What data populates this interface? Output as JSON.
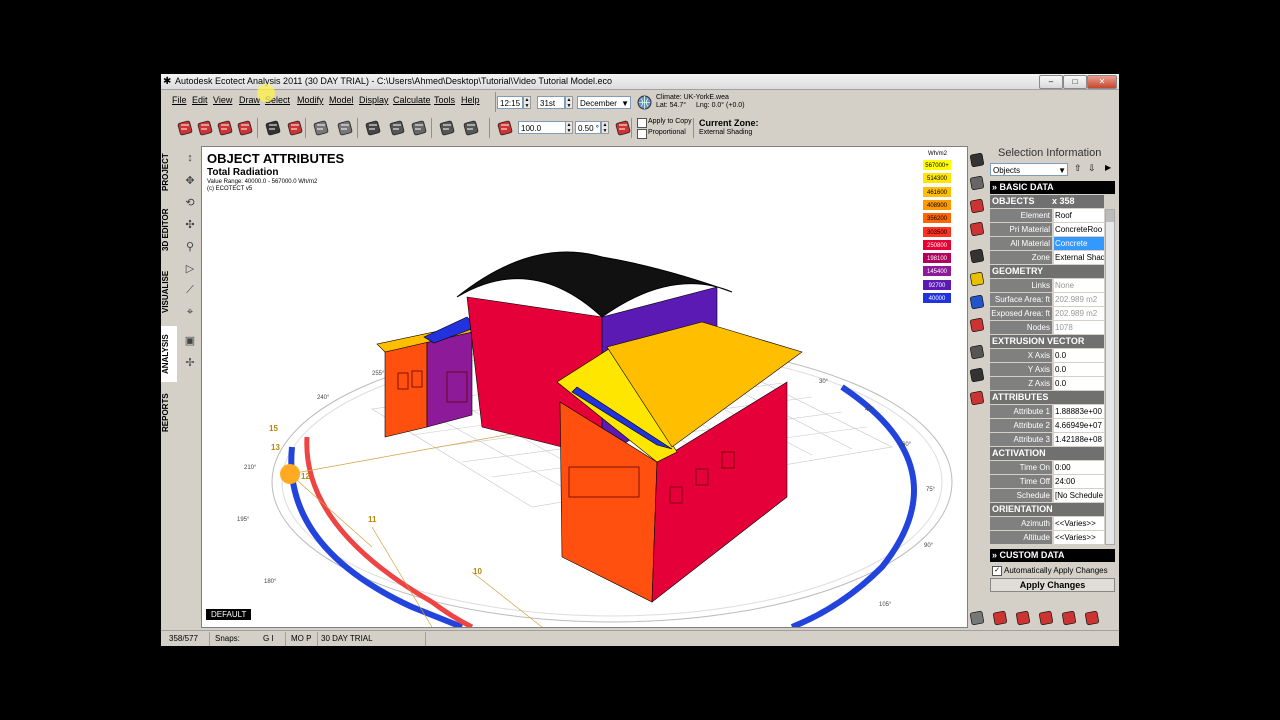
{
  "window": {
    "title": "Autodesk Ecotect Analysis 2011 (30 DAY TRIAL) - C:\\Users\\Ahmed\\Desktop\\Tutorial\\Video Tutorial Model.eco"
  },
  "menu": [
    "File",
    "Edit",
    "View",
    "Draw",
    "Select",
    "Modify",
    "Model",
    "Display",
    "Calculate",
    "Tools",
    "Help"
  ],
  "toolbar": {
    "time": "12:15",
    "day": "31st",
    "month": "December",
    "climate": "Climate: UK-YorkE.wea",
    "lat": "Lat: 54.7°",
    "lng": "Lng: 0.0° (+0.0)",
    "scale": "100.0",
    "angle": "0.50 °",
    "apply_to_copy": "Apply to Copy",
    "proportional": "Proportional",
    "current_zone_label": "Current Zone:",
    "current_zone_value": "External Shading"
  },
  "left_tabs": [
    "PROJECT",
    "3D EDITOR",
    "VISUALISE",
    "ANALYSIS",
    "REPORTS"
  ],
  "viewport": {
    "title": "OBJECT ATTRIBUTES",
    "subtitle": "Total Radiation",
    "range": "Value Range: 40000.0 - 567000.0 Wh/m2",
    "credit": "(c) ECOTECT v5",
    "tab": "DEFAULT",
    "legend_unit": "Wh/m2",
    "legend": [
      {
        "label": "567000+",
        "color": "#ffff00"
      },
      {
        "label": "514300",
        "color": "#ffe600"
      },
      {
        "label": "461600",
        "color": "#ffbf00"
      },
      {
        "label": "408900",
        "color": "#ff9900"
      },
      {
        "label": "356200",
        "color": "#ff6600"
      },
      {
        "label": "303500",
        "color": "#ff3322"
      },
      {
        "label": "250800",
        "color": "#e60033"
      },
      {
        "label": "198100",
        "color": "#b3005c"
      },
      {
        "label": "145400",
        "color": "#8c1a99"
      },
      {
        "label": "92700",
        "color": "#5a1ab3"
      },
      {
        "label": "40000",
        "color": "#2233dd"
      }
    ],
    "compass": [
      "255°",
      "240°",
      "210°",
      "195°",
      "180°",
      "30°",
      "45°",
      "60°",
      "75°",
      "90°",
      "105°"
    ],
    "sun_hours": [
      "15",
      "13",
      "12",
      "11",
      "10"
    ]
  },
  "panel": {
    "title": "Selection Information",
    "dropdown": "Objects",
    "basic_data": "BASIC DATA",
    "objects_label": "OBJECTS",
    "objects_count": "x 358",
    "rows_basic": [
      {
        "label": "Element",
        "value": "Roof"
      },
      {
        "label": "Pri Material",
        "value": "ConcreteRoo"
      },
      {
        "label": "All Material",
        "value": "Concrete"
      },
      {
        "label": "Zone",
        "value": "External Shad"
      }
    ],
    "geometry": "GEOMETRY",
    "rows_geometry": [
      {
        "label": "Links",
        "value": "None"
      },
      {
        "label": "Surface Area: ft",
        "value": "202.989 m2"
      },
      {
        "label": "Exposed Area: ft",
        "value": "202.989 m2"
      },
      {
        "label": "Nodes",
        "value": "1078"
      }
    ],
    "extrusion": "EXTRUSION VECTOR",
    "rows_extrusion": [
      {
        "label": "X Axis",
        "value": "0.0"
      },
      {
        "label": "Y Axis",
        "value": "0.0"
      },
      {
        "label": "Z Axis",
        "value": "0.0"
      }
    ],
    "attributes": "ATTRIBUTES",
    "rows_attributes": [
      {
        "label": "Attribute 1",
        "value": "1.88883e+00"
      },
      {
        "label": "Attribute 2",
        "value": "4.66949e+07"
      },
      {
        "label": "Attribute 3",
        "value": "1.42188e+08"
      }
    ],
    "activation": "ACTIVATION",
    "rows_activation": [
      {
        "label": "Time On",
        "value": "0:00"
      },
      {
        "label": "Time Off",
        "value": "24:00"
      },
      {
        "label": "Schedule",
        "value": "[No Schedule"
      }
    ],
    "orientation": "ORIENTATION",
    "rows_orientation": [
      {
        "label": "Azimuth",
        "value": "<<Varies>>"
      },
      {
        "label": "Altitude",
        "value": "<<Varies>>"
      }
    ],
    "custom_data": "CUSTOM DATA",
    "auto_apply": "Automatically Apply Changes",
    "apply_button": "Apply Changes"
  },
  "status": {
    "count": "358/577",
    "snaps": "Snaps:",
    "gi": "G I",
    "mop": "MO P",
    "trial": "30 DAY TRIAL"
  }
}
